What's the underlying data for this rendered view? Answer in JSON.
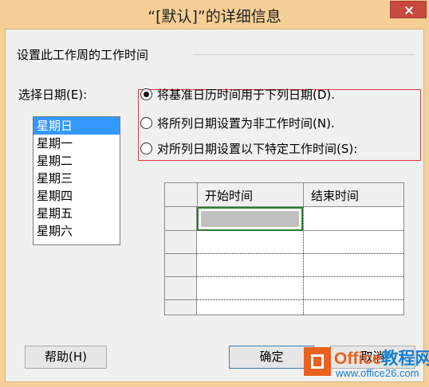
{
  "window": {
    "title": "“[默认]”的详细信息"
  },
  "group": {
    "label": "设置此工作周的工作时间"
  },
  "day_select": {
    "label": "选择日期(E):",
    "items": [
      "星期日",
      "星期一",
      "星期二",
      "星期三",
      "星期四",
      "星期五",
      "星期六"
    ],
    "selected": "星期日"
  },
  "options": [
    {
      "label": "将基准日历时间用于下列日期(D).",
      "checked": true
    },
    {
      "label": "将所列日期设置为非工作时间(N).",
      "checked": false
    },
    {
      "label": "对所列日期设置以下特定工作时间(S):",
      "checked": false
    }
  ],
  "time_table": {
    "columns": [
      "开始时间",
      "结束时间"
    ]
  },
  "buttons": {
    "help": "帮助(H)",
    "ok": "确定",
    "cancel": "取消"
  },
  "watermark": {
    "brand": "Office",
    "brand_cn": "教程网",
    "url": "www.office26.com"
  }
}
